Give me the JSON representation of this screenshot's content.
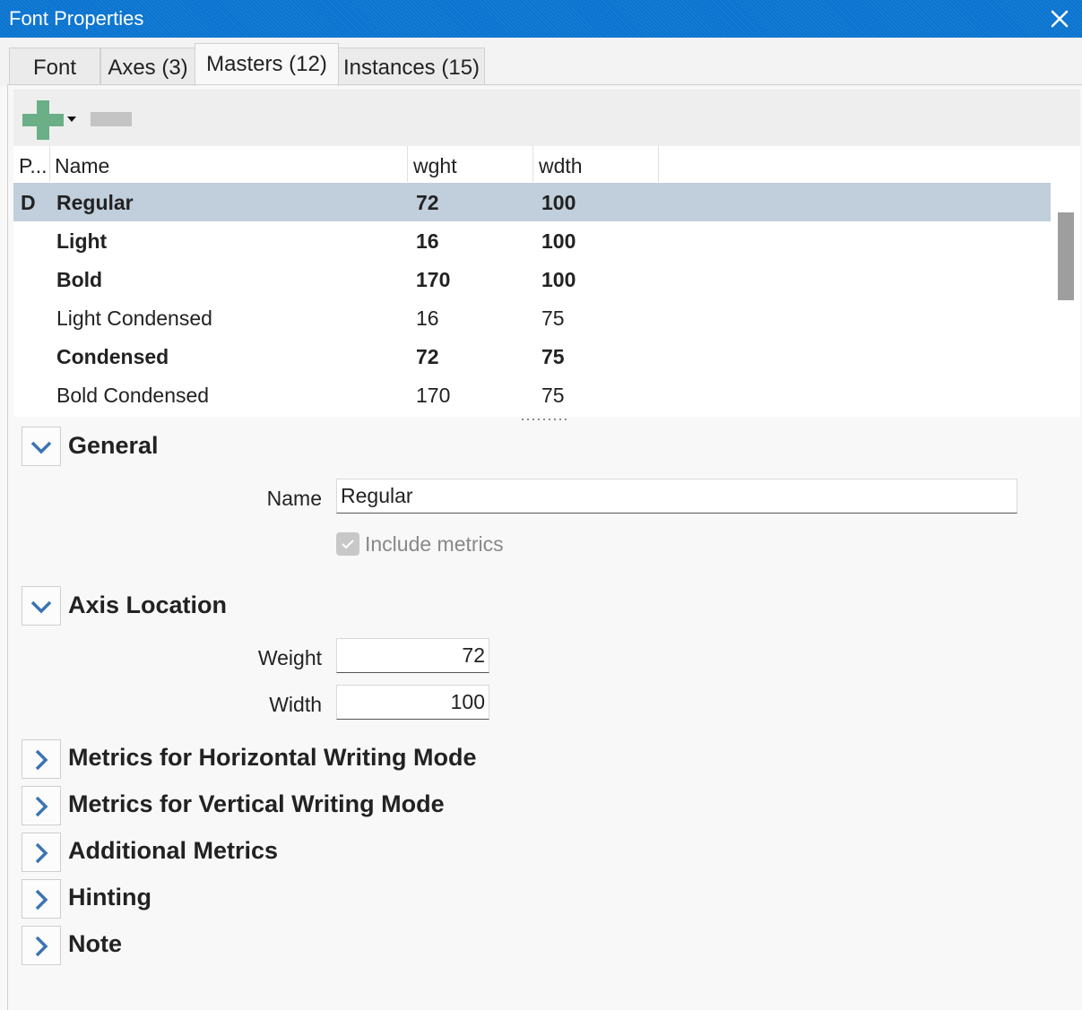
{
  "window": {
    "title": "Font Properties"
  },
  "tabs": [
    {
      "label": "Font"
    },
    {
      "label": "Axes (3)"
    },
    {
      "label": "Masters (12)",
      "active": true
    },
    {
      "label": "Instances (15)"
    }
  ],
  "toolbar": {
    "add_icon": "plus-icon",
    "remove_icon": "minus-icon"
  },
  "table": {
    "headers": [
      "P...",
      "Name",
      "wght",
      "wdth"
    ],
    "rows": [
      {
        "p": "D",
        "name": "Regular",
        "wght": "72",
        "wdth": "100",
        "bold": true,
        "selected": true
      },
      {
        "p": "",
        "name": "Light",
        "wght": "16",
        "wdth": "100",
        "bold": true
      },
      {
        "p": "",
        "name": "Bold",
        "wght": "170",
        "wdth": "100",
        "bold": true
      },
      {
        "p": "",
        "name": "Light Condensed",
        "wght": "16",
        "wdth": "75",
        "bold": false
      },
      {
        "p": "",
        "name": "Condensed",
        "wght": "72",
        "wdth": "75",
        "bold": true
      },
      {
        "p": "",
        "name": "Bold Condensed",
        "wght": "170",
        "wdth": "75",
        "bold": false
      }
    ]
  },
  "general": {
    "title": "General",
    "name_label": "Name",
    "name_value": "Regular",
    "include_metrics_label": "Include metrics",
    "include_metrics_checked": true
  },
  "axis_location": {
    "title": "Axis Location",
    "weight_label": "Weight",
    "weight_value": "72",
    "width_label": "Width",
    "width_value": "100"
  },
  "collapsed_sections": [
    {
      "title": "Metrics for Horizontal Writing Mode"
    },
    {
      "title": "Metrics for Vertical Writing Mode"
    },
    {
      "title": "Additional Metrics"
    },
    {
      "title": "Hinting"
    },
    {
      "title": "Note"
    }
  ],
  "colors": {
    "titlebar": "#0a74d0",
    "selected_row": "#c1cedb",
    "expander_arrow": "#3b74b3",
    "add_icon": "#6aaf87"
  }
}
